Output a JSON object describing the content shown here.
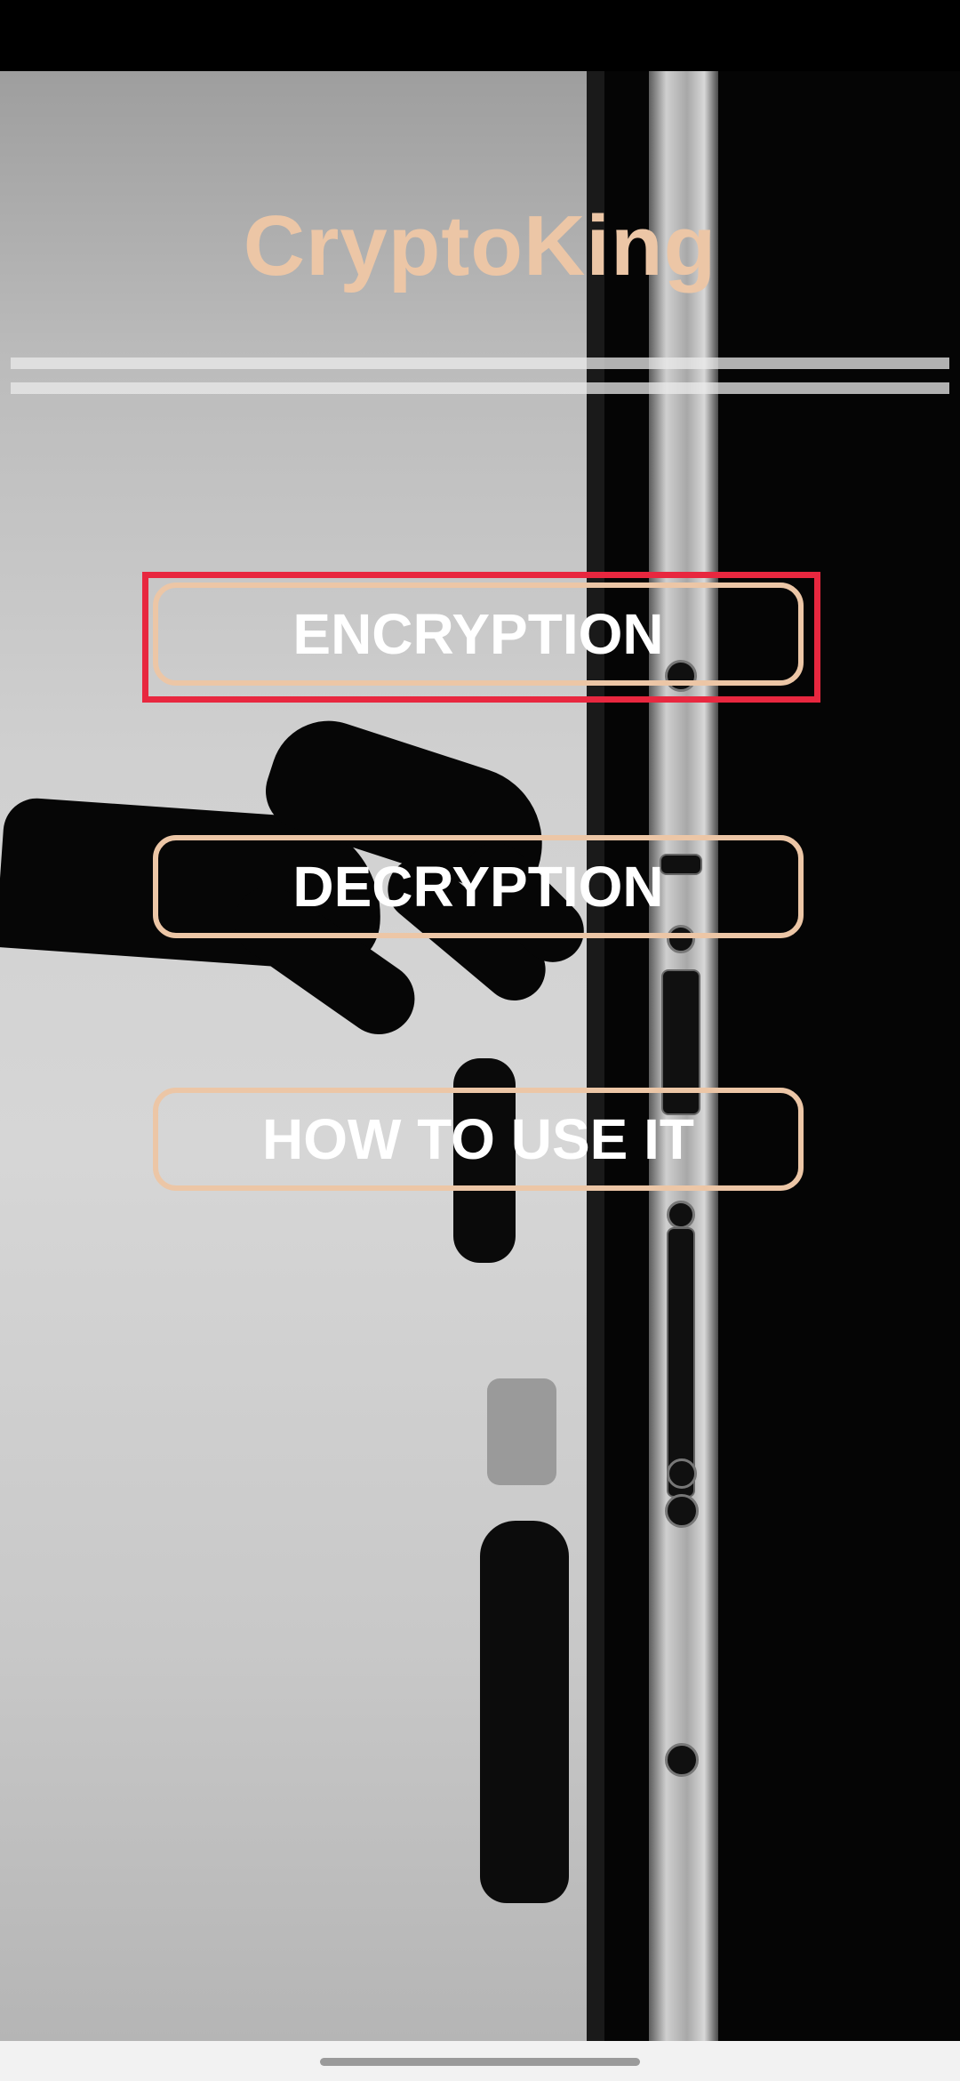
{
  "app": {
    "title": "CryptoKing"
  },
  "menu": {
    "encryption_label": "ENCRYPTION",
    "decryption_label": "DECRYPTION",
    "howto_label": "HOW TO USE IT"
  },
  "colors": {
    "accent": "#ecc6a6",
    "highlight": "#e8273f",
    "button_text": "#ffffff"
  }
}
